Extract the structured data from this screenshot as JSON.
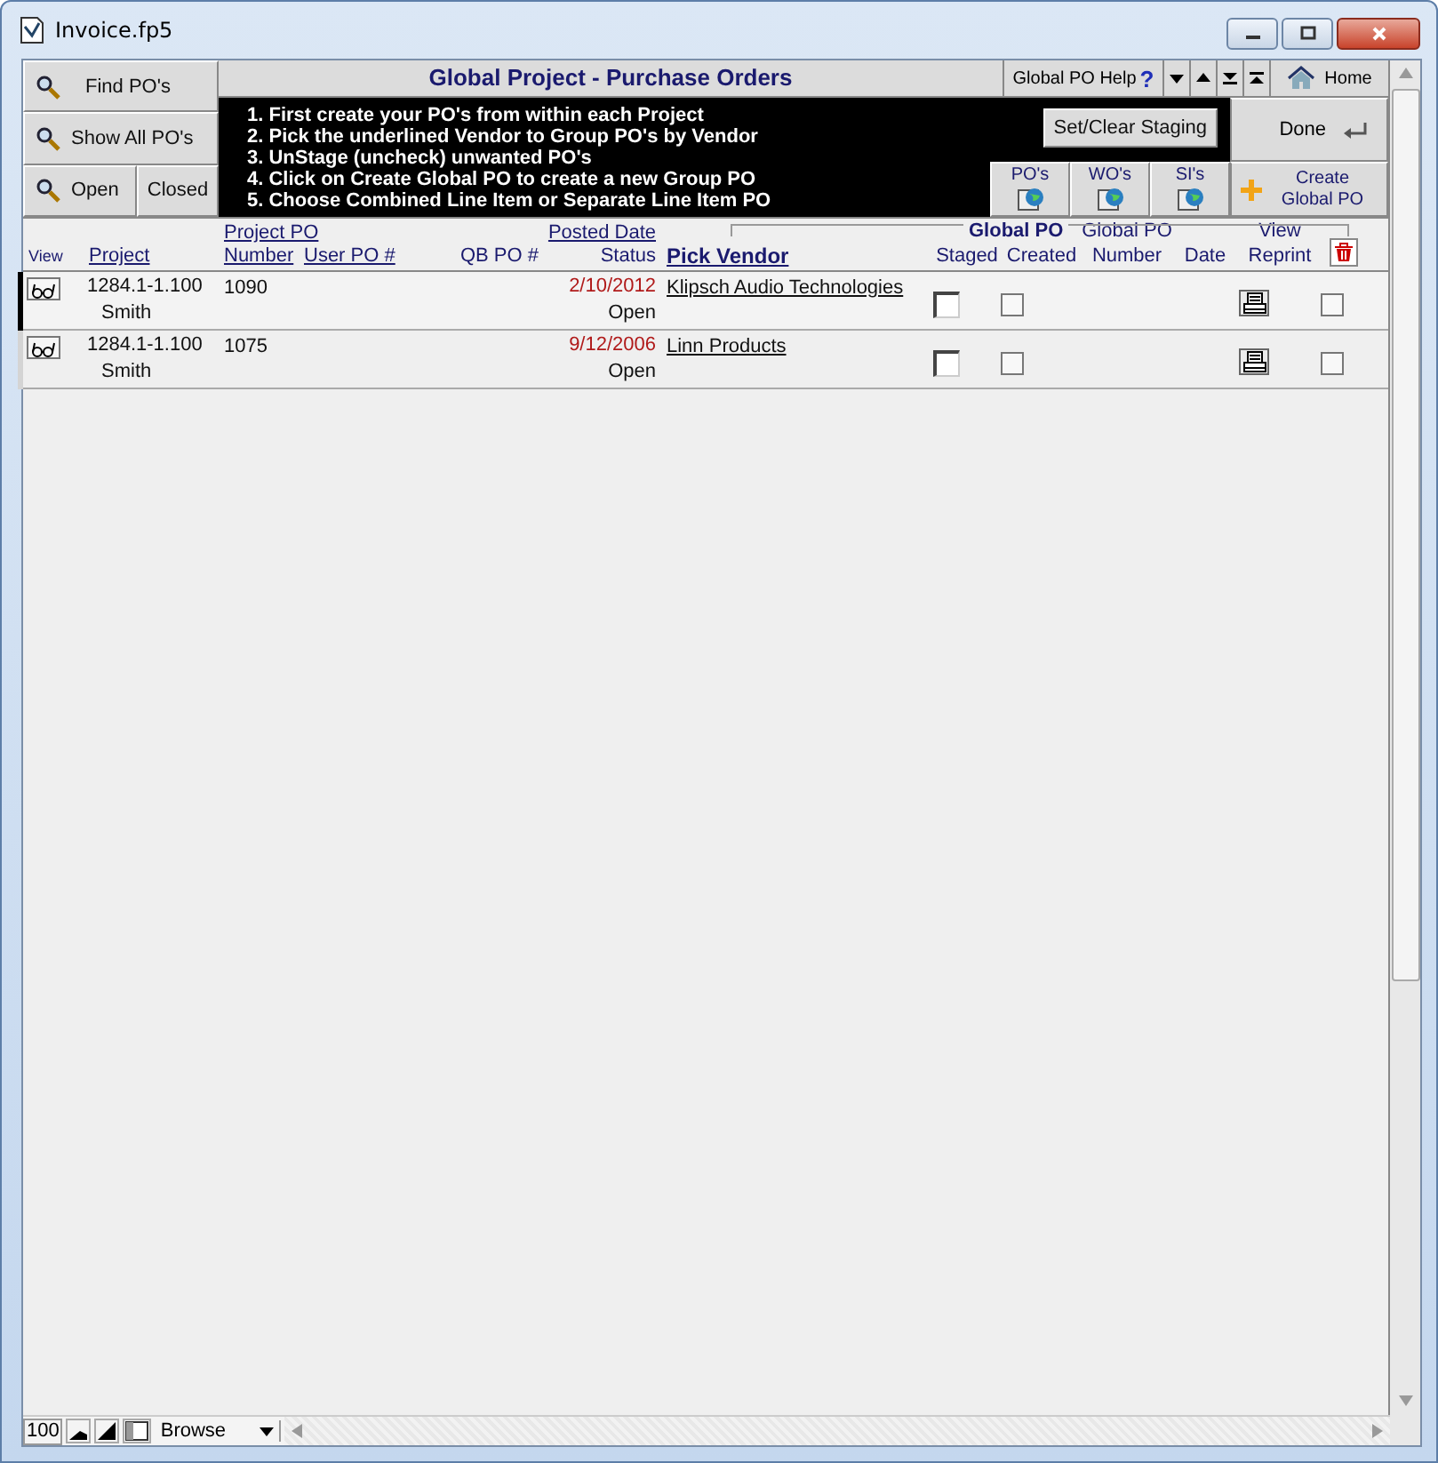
{
  "window": {
    "title": "Invoice.fp5"
  },
  "sidebar": {
    "buttons": [
      {
        "label": "Find PO's",
        "icon": true
      },
      {
        "label": "Show All PO's",
        "icon": true
      },
      {
        "label": "Open",
        "icon": true
      },
      {
        "label": "Closed",
        "icon": false
      }
    ]
  },
  "header": {
    "title": "Global Project - Purchase Orders",
    "help": "Global PO Help",
    "help_mark": "?",
    "home": "Home",
    "done": "Done",
    "create": "Create Global PO",
    "staging": "Set/Clear Staging",
    "instructions": [
      "1. First create your PO's from within each Project",
      "2. Pick the underlined Vendor to Group PO's by Vendor",
      "3. UnStage (uncheck) unwanted PO's",
      "4. Click on Create Global PO to create a new Group PO",
      "5. Choose Combined Line Item or Separate Line Item PO"
    ],
    "links": [
      "PO's",
      "WO's",
      "SI's"
    ]
  },
  "table": {
    "group_label": "Global PO",
    "columns": [
      {
        "label": "View",
        "link": false
      },
      {
        "label": "Project",
        "link": true
      },
      {
        "top": "Project PO",
        "top_link": true,
        "label": "Number",
        "link": true
      },
      {
        "label": "User PO #",
        "link": true
      },
      {
        "label": "QB PO #",
        "link": false
      },
      {
        "top": "Posted Date",
        "top_link": true,
        "label": "Status",
        "link": false
      },
      {
        "label": "Pick Vendor",
        "link": true
      },
      {
        "label": "Staged",
        "link": false
      },
      {
        "label": "Created",
        "link": false
      },
      {
        "top": "Global PO",
        "top_link": false,
        "label": "Number",
        "link": false
      },
      {
        "label": "Date",
        "link": false
      },
      {
        "top": "View",
        "top_link": false,
        "label": "Reprint",
        "link": false
      }
    ],
    "rows": [
      {
        "selected": true,
        "project": "1284.1-1.100",
        "owner": "Smith",
        "number": "1090",
        "posted_date": "2/10/2012",
        "status": "Open",
        "vendor": "Klipsch Audio Technologies",
        "staged": false,
        "created": false,
        "delete": false
      },
      {
        "selected": false,
        "project": "1284.1-1.100",
        "owner": "Smith",
        "number": "1075",
        "posted_date": "9/12/2006",
        "status": "Open",
        "vendor": "Linn Products",
        "staged": false,
        "created": false,
        "delete": false
      }
    ]
  },
  "status_bar": {
    "zoom": "100",
    "mode": "Browse"
  }
}
